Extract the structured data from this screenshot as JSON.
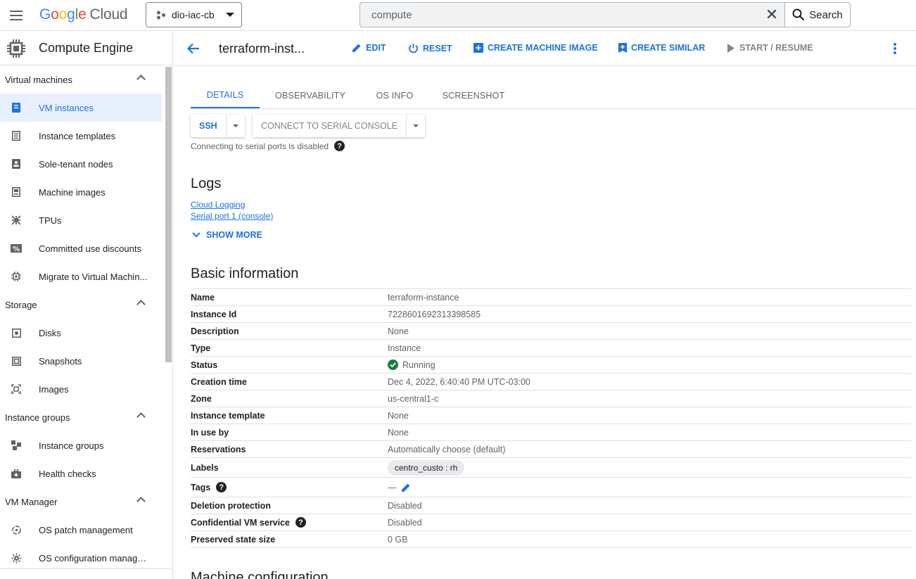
{
  "topbar": {
    "logo_google": "Google",
    "logo_cloud": "Cloud",
    "project": "dio-iac-cb",
    "search_value": "compute",
    "search_button": "Search"
  },
  "sidebar": {
    "title": "Compute Engine",
    "sections": [
      {
        "label": "Virtual machines",
        "items": [
          {
            "label": "VM instances",
            "icon": "vm-instance-icon",
            "active": true
          },
          {
            "label": "Instance templates",
            "icon": "template-icon"
          },
          {
            "label": "Sole-tenant nodes",
            "icon": "sole-tenant-icon"
          },
          {
            "label": "Machine images",
            "icon": "machine-image-icon"
          },
          {
            "label": "TPUs",
            "icon": "tpu-icon"
          },
          {
            "label": "Committed use discounts",
            "icon": "percent-icon"
          },
          {
            "label": "Migrate to Virtual Machin...",
            "icon": "migrate-icon"
          }
        ]
      },
      {
        "label": "Storage",
        "items": [
          {
            "label": "Disks",
            "icon": "disk-icon"
          },
          {
            "label": "Snapshots",
            "icon": "snapshot-icon"
          },
          {
            "label": "Images",
            "icon": "image-icon"
          }
        ]
      },
      {
        "label": "Instance groups",
        "items": [
          {
            "label": "Instance groups",
            "icon": "instance-group-icon"
          },
          {
            "label": "Health checks",
            "icon": "health-check-icon"
          }
        ]
      },
      {
        "label": "VM Manager",
        "items": [
          {
            "label": "OS patch management",
            "icon": "patch-icon"
          },
          {
            "label": "OS configuration manage...",
            "icon": "os-config-icon"
          }
        ]
      }
    ]
  },
  "actionbar": {
    "title": "terraform-inst...",
    "edit": "EDIT",
    "reset": "RESET",
    "create_machine_image": "CREATE MACHINE IMAGE",
    "create_similar": "CREATE SIMILAR",
    "start_resume": "START / RESUME"
  },
  "tabs": [
    "DETAILS",
    "OBSERVABILITY",
    "OS INFO",
    "SCREENSHOT"
  ],
  "connect": {
    "ssh": "SSH",
    "serial_console": "CONNECT TO SERIAL CONSOLE",
    "note": "Connecting to serial ports is disabled"
  },
  "logs": {
    "heading": "Logs",
    "cloud_logging": "Cloud Logging",
    "serial_port": "Serial port 1 (console)",
    "show_more": "SHOW MORE"
  },
  "basic_info": {
    "heading": "Basic information",
    "rows": [
      {
        "key": "Name",
        "value": "terraform-instance"
      },
      {
        "key": "Instance Id",
        "value": "7228601692313398585"
      },
      {
        "key": "Description",
        "value": "None"
      },
      {
        "key": "Type",
        "value": "Instance"
      },
      {
        "key": "Status",
        "value": "Running"
      },
      {
        "key": "Creation time",
        "value": "Dec 4, 2022, 6:40:40 PM UTC-03:00"
      },
      {
        "key": "Zone",
        "value": "us-central1-c"
      },
      {
        "key": "Instance template",
        "value": "None"
      },
      {
        "key": "In use by",
        "value": "None"
      },
      {
        "key": "Reservations",
        "value": "Automatically choose (default)"
      },
      {
        "key": "Labels",
        "value": "centro_custo : rh"
      },
      {
        "key": "Tags",
        "value": "—"
      },
      {
        "key": "Deletion protection",
        "value": "Disabled"
      },
      {
        "key": "Confidential VM service",
        "value": "Disabled"
      },
      {
        "key": "Preserved state size",
        "value": "0 GB"
      }
    ]
  },
  "machine_config": {
    "heading": "Machine configuration"
  },
  "colors": {
    "accent": "#1a73e8",
    "active_bg": "#e8f0fe",
    "running": "#188038"
  }
}
